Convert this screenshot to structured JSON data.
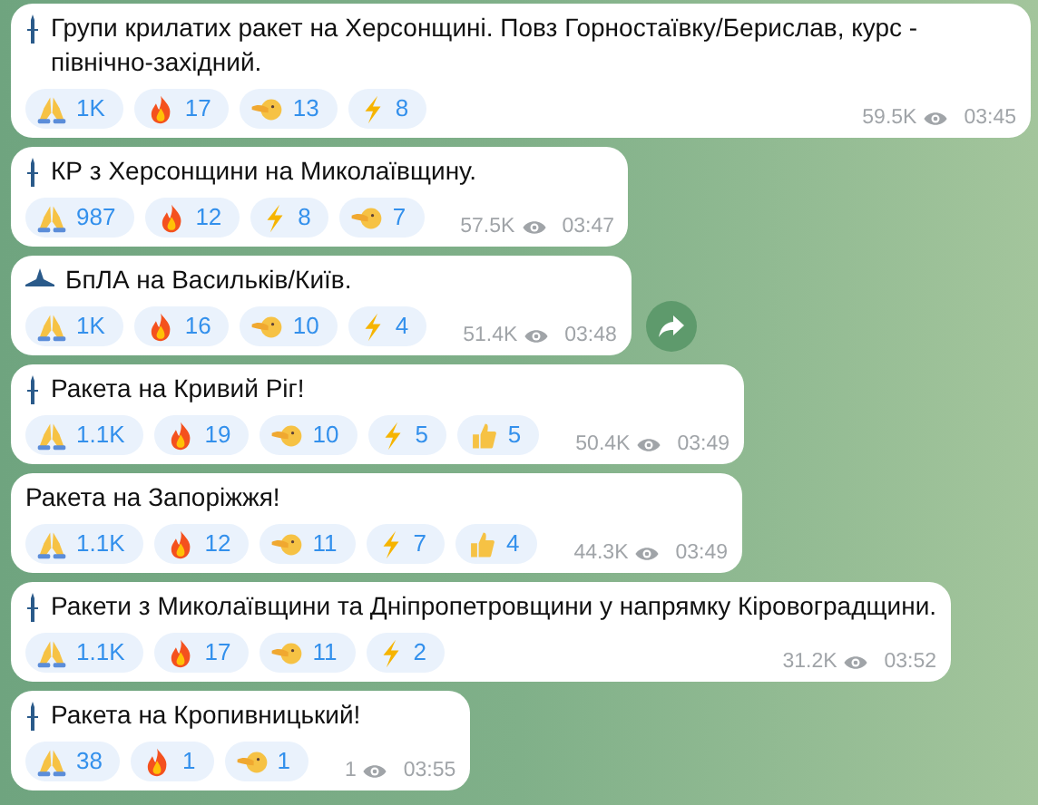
{
  "messages": [
    {
      "kind": "missile",
      "text": "Групи крилатих ракет на Херсонщині. Повз Горностаївку/Берислав, курс - північно-західний.",
      "reactions": [
        {
          "kind": "pray",
          "count": "1K"
        },
        {
          "kind": "fire",
          "count": "17"
        },
        {
          "kind": "face",
          "count": "13"
        },
        {
          "kind": "bolt",
          "count": "8"
        }
      ],
      "views": "59.5K",
      "time": "03:45",
      "forward": false
    },
    {
      "kind": "missile",
      "text": "КР з Херсонщини на Миколаївщину.",
      "reactions": [
        {
          "kind": "pray",
          "count": "987"
        },
        {
          "kind": "fire",
          "count": "12"
        },
        {
          "kind": "bolt",
          "count": "8"
        },
        {
          "kind": "face",
          "count": "7"
        }
      ],
      "views": "57.5K",
      "time": "03:47",
      "forward": false
    },
    {
      "kind": "drone",
      "text": "БпЛА на Васильків/Київ.",
      "reactions": [
        {
          "kind": "pray",
          "count": "1K"
        },
        {
          "kind": "fire",
          "count": "16"
        },
        {
          "kind": "face",
          "count": "10"
        },
        {
          "kind": "bolt",
          "count": "4"
        }
      ],
      "views": "51.4K",
      "time": "03:48",
      "forward": true
    },
    {
      "kind": "missile",
      "text": "Ракета на Кривий Ріг!",
      "reactions": [
        {
          "kind": "pray",
          "count": "1.1K"
        },
        {
          "kind": "fire",
          "count": "19"
        },
        {
          "kind": "face",
          "count": "10"
        },
        {
          "kind": "bolt",
          "count": "5"
        },
        {
          "kind": "thumbs",
          "count": "5"
        }
      ],
      "views": "50.4K",
      "time": "03:49",
      "forward": false
    },
    {
      "kind": "plain",
      "text": "Ракета на Запоріжжя!",
      "reactions": [
        {
          "kind": "pray",
          "count": "1.1K"
        },
        {
          "kind": "fire",
          "count": "12"
        },
        {
          "kind": "face",
          "count": "11"
        },
        {
          "kind": "bolt",
          "count": "7"
        },
        {
          "kind": "thumbs",
          "count": "4"
        }
      ],
      "views": "44.3K",
      "time": "03:49",
      "forward": false
    },
    {
      "kind": "missile",
      "text": "Ракети з Миколаївщини та Дніпропетровщини у напрямку Кіровоградщини.",
      "reactions": [
        {
          "kind": "pray",
          "count": "1.1K"
        },
        {
          "kind": "fire",
          "count": "17"
        },
        {
          "kind": "face",
          "count": "11"
        },
        {
          "kind": "bolt",
          "count": "2"
        }
      ],
      "views": "31.2K",
      "time": "03:52",
      "forward": false
    },
    {
      "kind": "missile",
      "text": "Ракета на Кропивницький!",
      "reactions": [
        {
          "kind": "pray",
          "count": "38"
        },
        {
          "kind": "fire",
          "count": "1"
        },
        {
          "kind": "face",
          "count": "1"
        }
      ],
      "views": "1",
      "time": "03:55",
      "forward": false
    }
  ]
}
